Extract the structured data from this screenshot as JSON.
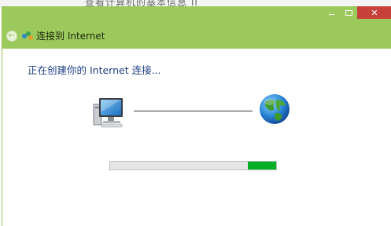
{
  "background_window": {
    "partial_text": "查看计算机的基本信息 II"
  },
  "window": {
    "title": "连接到 Internet",
    "controls": {
      "minimize": "",
      "maximize": "",
      "close": "✕"
    },
    "back_icon": "back-arrow-icon",
    "app_icon": "network-connection-icon"
  },
  "main": {
    "status_text": "正在创建你的 Internet 连接...",
    "left_icon": "computer-icon",
    "right_icon": "globe-icon",
    "progress": {
      "fill_start_fraction": 0.83,
      "fill_end_fraction": 1.0,
      "color": "#06b025"
    }
  },
  "colors": {
    "titlebar": "#9cc95c",
    "status_text": "#1f3f86",
    "close_button": "#c7413a"
  }
}
